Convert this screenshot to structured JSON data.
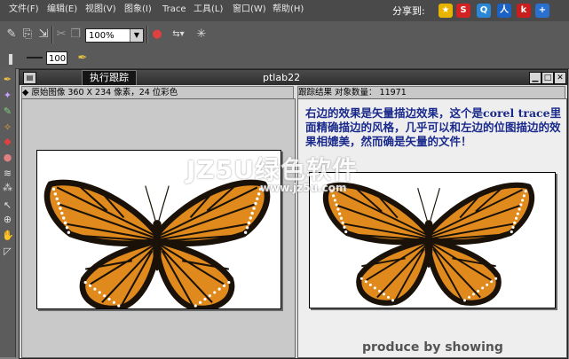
{
  "menubar": {
    "items": [
      "文件(F)",
      "编辑(E)",
      "视图(V)",
      "图象(I)",
      "Trace",
      "工具(L)",
      "窗口(W)",
      "帮助(H)"
    ],
    "share_label": "分享到:"
  },
  "toolbar": {
    "zoom_value": "100%",
    "number_value": "100"
  },
  "window": {
    "tab_label": "执行跟踪",
    "title": "ptlab22"
  },
  "left_pane": {
    "header": "原始图像    360 X 234 像素，24 位彩色"
  },
  "right_pane": {
    "header": "跟踪结果    对象数量： 11971",
    "description": "右边的效果是矢量描边效果，这个是corel trace里面精确描边的风格，几乎可以和左边的位图描边的效果相媲美，然而确是矢量的文件！",
    "produce_text": "produce by showing"
  },
  "watermark": {
    "main": "JZ5U绿色软件",
    "url": "www.jz5u.com"
  },
  "colors": {
    "wing_orange": "#e08a1e",
    "vein_black": "#1a1208",
    "description_blue": "#1a2a8c"
  }
}
